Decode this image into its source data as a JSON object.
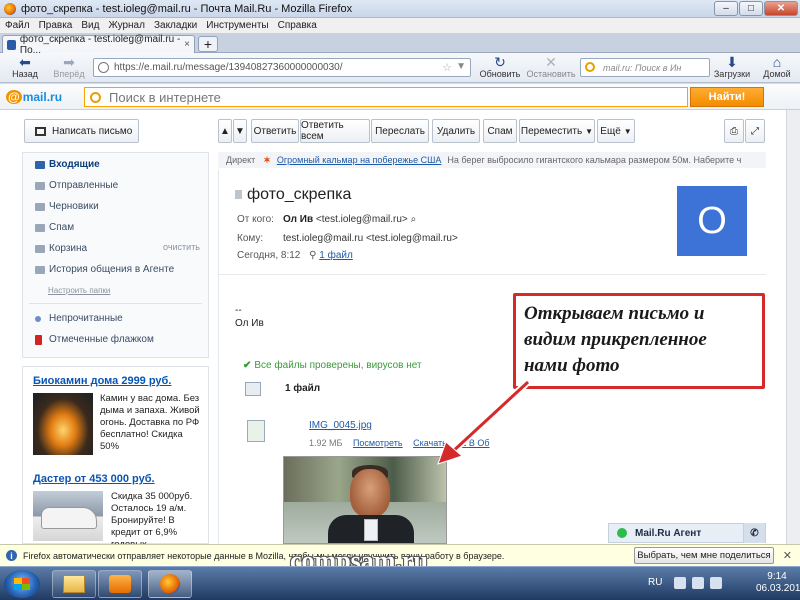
{
  "window": {
    "title": "фото_скрепка - test.ioleg@mail.ru - Почта Mail.Ru - Mozilla Firefox",
    "buttons": [
      "–",
      "□",
      "✕"
    ]
  },
  "menu": [
    "Файл",
    "Правка",
    "Вид",
    "Журнал",
    "Закладки",
    "Инструменты",
    "Справка"
  ],
  "tab": {
    "label": "фото_скрепка - test.ioleg@mail.ru - По...",
    "close": "×",
    "new": "+"
  },
  "nav": {
    "back": "Назад",
    "forward": "Вперёд",
    "url": "https://e.mail.ru/message/13940827360000000030/",
    "reload": "Обновить",
    "stop": "Остановить",
    "search_placeholder": "mail.ru: Поиск в Ин",
    "downloads": "Загрузки",
    "home": "Домой"
  },
  "mailbar": {
    "logo_at": "@",
    "logo": "mail.ru",
    "search_placeholder": "Поиск в интернете",
    "find": "Найти!"
  },
  "sidebar": {
    "compose": "Написать письмо",
    "folders": [
      {
        "label": "Входящие"
      },
      {
        "label": "Отправленные"
      },
      {
        "label": "Черновики"
      },
      {
        "label": "Спам"
      },
      {
        "label": "Корзина"
      },
      {
        "label": "История общения в Агенте"
      }
    ],
    "clear": "очистить",
    "setup": "Настроить папки",
    "unread": "Непрочитанные",
    "flagged": "Отмеченные флажком"
  },
  "ads": [
    {
      "title": "Биокамин дома 2999 руб.",
      "text": "Камин у вас дома. Без дыма и запаха. Живой огонь. Доставка по РФ бесплатно! Скидка 50%"
    },
    {
      "title": "Дастер от 453 000 руб.",
      "text": "Скидка 35 000руб. Осталось 19 а/м. Бронируйте! В кредит от 6,9% годовых"
    }
  ],
  "toolbar": {
    "reply": "Ответить",
    "reply_all": "Ответить всем",
    "forward": "Переслать",
    "delete": "Удалить",
    "spam": "Спам",
    "move": "Переместить",
    "more": "Ещё"
  },
  "direct": {
    "label": "Директ",
    "link": "Огромный кальмар на побережье США",
    "text": "На берег выбросило гигантского кальмара размером 50м. Наберите ч"
  },
  "message": {
    "subject": "фото_скрепка",
    "from_label": "От кого:",
    "from_name": "Ол Ив",
    "from_email": "<test.ioleg@mail.ru>",
    "to_label": "Кому:",
    "to_value": "test.ioleg@mail.ru <test.ioleg@mail.ru>",
    "date": "Сегодня, 8:12",
    "files_link": "1 файл",
    "avatar_letter": "О",
    "body_line1": "--",
    "body_line2": "Ол Ив",
    "virus_check": "Все файлы проверены, вирусов нет",
    "files_count": "1 файл",
    "attachment": {
      "name": "IMG_0045.jpg",
      "size": "1.92 МБ",
      "view": "Посмотреть",
      "download": "Скачать",
      "cloud": "В Об"
    }
  },
  "callout": {
    "text": "Открываем письмо и видим прикрепленное нами фото",
    "border_color": "#d42a2a"
  },
  "agent": {
    "label": "Mail.Ru Агент"
  },
  "notification": {
    "text": "Firefox автоматически отправляет некоторые данные в Mozilla, чтобы мы могли улучшить вашу работу в браузере.",
    "button": "Выбрать, чем мне поделиться",
    "close": "✕"
  },
  "watermark": "compsam.ru",
  "tray": {
    "lang": "RU",
    "time": "9:14",
    "date": "06.03.2014"
  },
  "colors": {
    "accent": "#168de2",
    "orange": "#f38b00",
    "avatar": "#3d73d6"
  }
}
